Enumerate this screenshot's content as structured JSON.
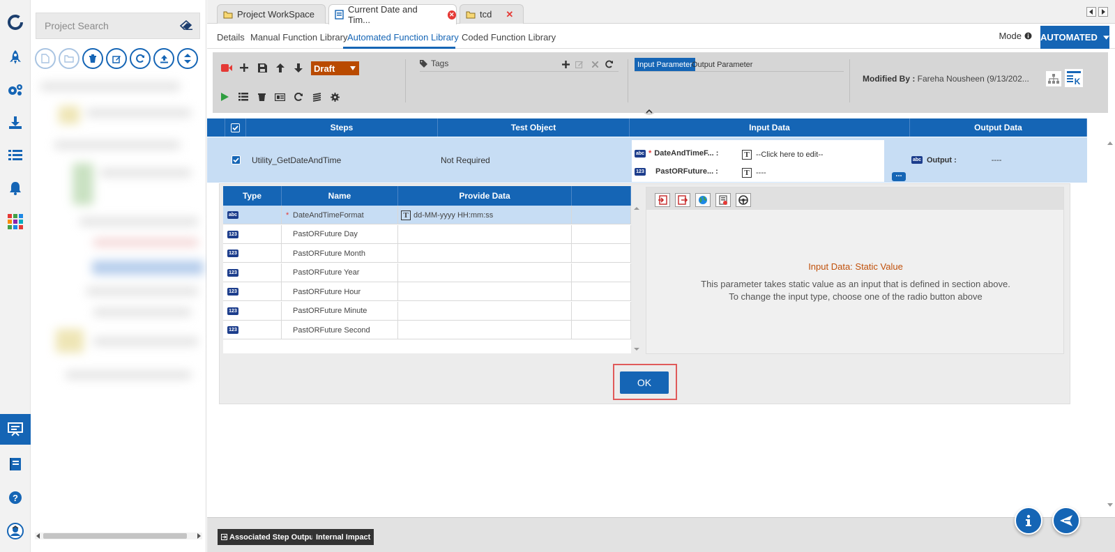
{
  "search": {
    "placeholder": "Project Search"
  },
  "tabs": [
    {
      "label": "Project WorkSpace"
    },
    {
      "label": "Current Date and Tim..."
    },
    {
      "label": "tcd"
    }
  ],
  "subnav": {
    "items": [
      "Details",
      "Manual Function Library",
      "Automated Function Library",
      "Coded Function Library"
    ],
    "active": "Automated Function Library",
    "mode_label": "Mode",
    "mode_value": "AUTOMATED"
  },
  "toolbar": {
    "status": "Draft",
    "tags_label": "Tags",
    "input_param_tab": "Input Parameter",
    "output_param_tab": "Output Parameter",
    "modified_label": "Modified By :",
    "modified_value": "Fareha Nousheen (9/13/202..."
  },
  "grid": {
    "headers": {
      "steps": "Steps",
      "test_object": "Test Object",
      "input_data": "Input Data",
      "output_data": "Output Data"
    },
    "row": {
      "step": "Utility_GetDateAndTime",
      "test_object": "Not Required",
      "inputs": [
        {
          "badge": "abc",
          "name": "DateAndTimeF... :",
          "value": "--Click here to edit--",
          "required": true
        },
        {
          "badge": "123",
          "name": "PastORFuture... :",
          "value": "----",
          "required": false
        }
      ],
      "output": {
        "badge": "abc",
        "name": "Output :",
        "value": "----"
      }
    }
  },
  "params": {
    "headers": {
      "type": "Type",
      "name": "Name",
      "provide_data": "Provide Data"
    },
    "rows": [
      {
        "badge": "abc",
        "name": "DateAndTimeFormat",
        "required": true,
        "value": "dd-MM-yyyy HH:mm:ss"
      },
      {
        "badge": "123",
        "name": "PastORFuture Day",
        "required": false,
        "value": ""
      },
      {
        "badge": "123",
        "name": "PastORFuture Month",
        "required": false,
        "value": ""
      },
      {
        "badge": "123",
        "name": "PastORFuture Year",
        "required": false,
        "value": ""
      },
      {
        "badge": "123",
        "name": "PastORFuture Hour",
        "required": false,
        "value": ""
      },
      {
        "badge": "123",
        "name": "PastORFuture Minute",
        "required": false,
        "value": ""
      },
      {
        "badge": "123",
        "name": "PastORFuture Second",
        "required": false,
        "value": ""
      }
    ]
  },
  "input_panel": {
    "title": "Input Data: Static Value",
    "line1": "This parameter takes static value as an input that is defined in section above.",
    "line2": "To change the input type, choose one of the radio button above"
  },
  "ok_label": "OK",
  "bottom": {
    "associated": "Associated Step Output",
    "internal": "Internal Impact"
  },
  "colors": {
    "primary": "#1565b5",
    "draft": "#b94a00",
    "highlight": "#c7ddf4",
    "required": "#e53935",
    "panel_title": "#c0500a"
  }
}
